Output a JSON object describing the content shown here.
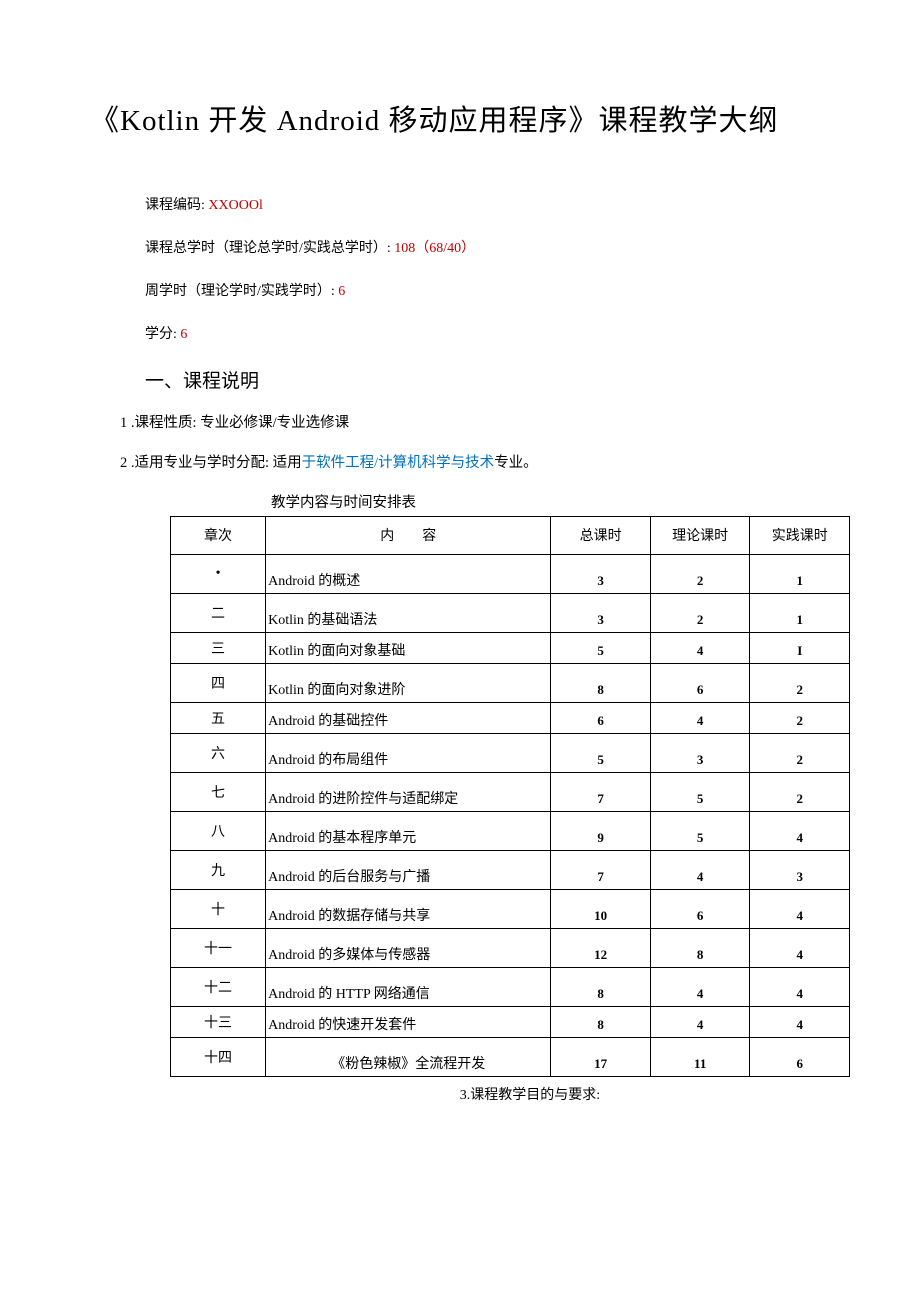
{
  "title": "《Kotlin 开发 Android 移动应用程序》课程教学大纲",
  "meta": {
    "code_label": "课程编码:",
    "code_value": "XXOOOl",
    "total_hours_label": "课程总学时（理论总学时/实践总学时）:",
    "total_hours_value": "108（68/40）",
    "weekly_hours_label": "周学时（理论学时/实践学时）:",
    "weekly_hours_value": "6",
    "credits_label": "学分:",
    "credits_value": "6"
  },
  "section1": {
    "heading": "一、课程说明",
    "line1": "1 .课程性质: 专业必修课/专业选修课",
    "line2_prefix": "2 .适用专业与学时分配: 适用",
    "line2_blue": "于软件工程/计算机科学与技术",
    "line2_suffix": "专业。"
  },
  "table": {
    "title": "教学内容与时间安排表",
    "headers": {
      "chapter": "章次",
      "content": "内容",
      "total": "总课时",
      "theory": "理论课时",
      "practice": "实践课时"
    },
    "rows": [
      {
        "chapter": "•",
        "content": "Android 的概述",
        "total": "3",
        "theory": "2",
        "practice": "1"
      },
      {
        "chapter": "二",
        "content": "Kotlin 的基础语法",
        "total": "3",
        "theory": "2",
        "practice": "1"
      },
      {
        "chapter": "三",
        "content": "Kotlin 的面向对象基础",
        "total": "5",
        "theory": "4",
        "practice": "I"
      },
      {
        "chapter": "四",
        "content": "Kotlin 的面向对象进阶",
        "total": "8",
        "theory": "6",
        "practice": "2"
      },
      {
        "chapter": "五",
        "content": "Android 的基础控件",
        "total": "6",
        "theory": "4",
        "practice": "2"
      },
      {
        "chapter": "六",
        "content": "Android 的布局组件",
        "total": "5",
        "theory": "3",
        "practice": "2"
      },
      {
        "chapter": "七",
        "content": "Android 的进阶控件与适配绑定",
        "total": "7",
        "theory": "5",
        "practice": "2"
      },
      {
        "chapter": "八",
        "content": "Android 的基本程序单元",
        "total": "9",
        "theory": "5",
        "practice": "4"
      },
      {
        "chapter": "九",
        "content": "Android 的后台服务与广播",
        "total": "7",
        "theory": "4",
        "practice": "3"
      },
      {
        "chapter": "十",
        "content": "Android 的数据存储与共享",
        "total": "10",
        "theory": "6",
        "practice": "4"
      },
      {
        "chapter": "十一",
        "content": "Android 的多媒体与传感器",
        "total": "12",
        "theory": "8",
        "practice": "4"
      },
      {
        "chapter": "十二",
        "content": "Android 的 HTTP 网络通信",
        "total": "8",
        "theory": "4",
        "practice": "4"
      },
      {
        "chapter": "十三",
        "content": "Android 的快速开发套件",
        "total": "8",
        "theory": "4",
        "practice": "4"
      },
      {
        "chapter": "十四",
        "content": "《粉色辣椒》全流程开发",
        "total": "17",
        "theory": "11",
        "practice": "6"
      }
    ]
  },
  "footer": "3.课程教学目的与要求:"
}
